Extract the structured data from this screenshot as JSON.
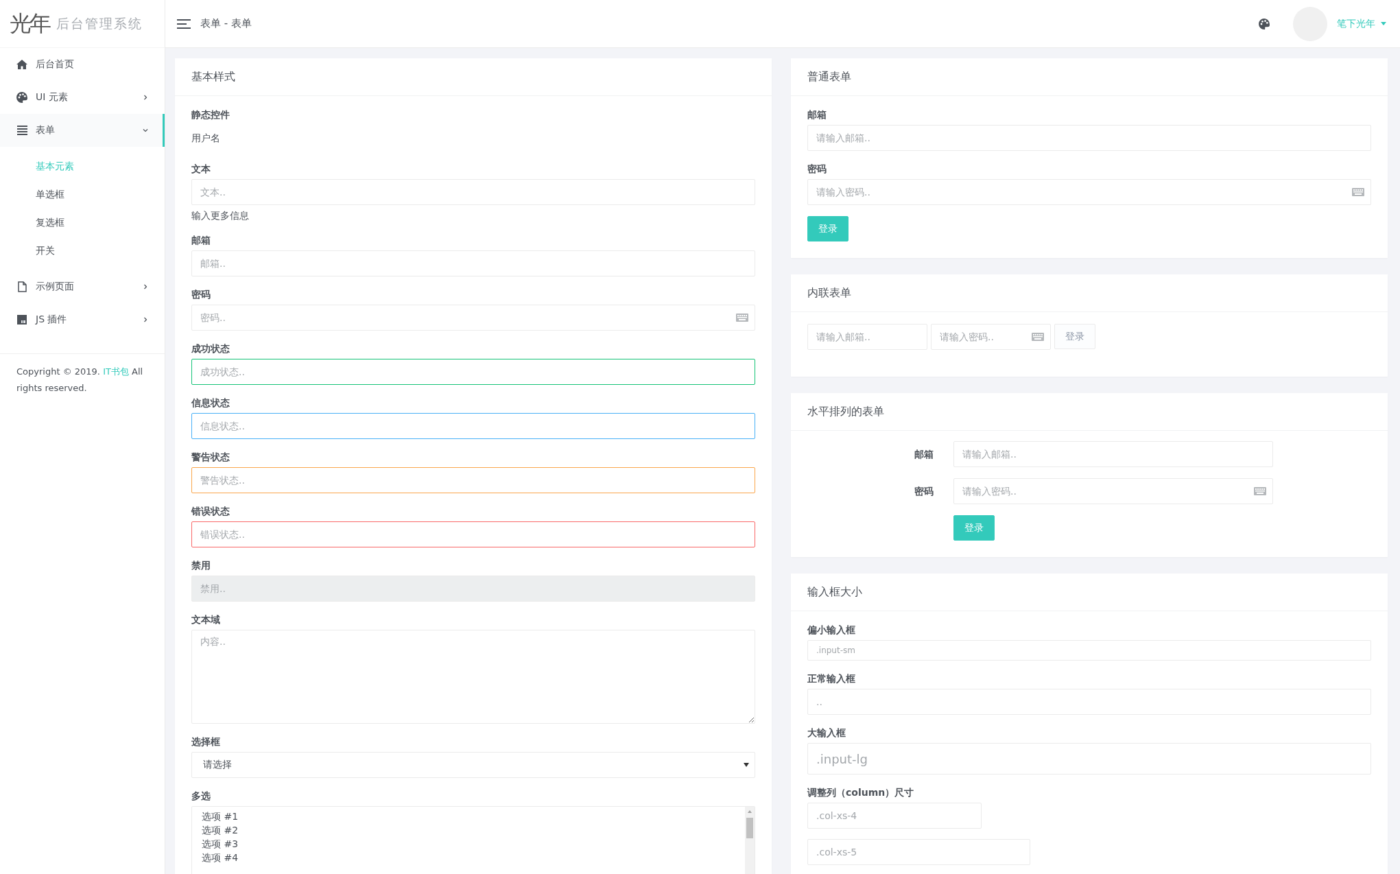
{
  "sidebar": {
    "logo": {
      "mark": "光年",
      "title": "后台管理系统"
    },
    "items": [
      {
        "kind": "link",
        "label": "后台首页",
        "selected": false
      },
      {
        "kind": "group",
        "label": "UI 元素",
        "selected": false,
        "expanded": false
      },
      {
        "kind": "group",
        "label": "表单",
        "selected": true,
        "expanded": true,
        "children": [
          {
            "label": "基本元素",
            "selected": true
          },
          {
            "label": "单选框",
            "selected": false
          },
          {
            "label": "复选框",
            "selected": false
          },
          {
            "label": "开关",
            "selected": false
          }
        ]
      },
      {
        "kind": "group",
        "label": "示例页面",
        "selected": false,
        "expanded": false
      },
      {
        "kind": "group",
        "label": "JS 插件",
        "selected": false,
        "expanded": false
      }
    ],
    "copyright": {
      "before": "Copyright © 2019.",
      "link": "IT书包",
      "after": "All rights reserved."
    }
  },
  "header": {
    "breadcrumb": "表单 - 表单",
    "user": "笔下光年"
  },
  "basic_styles": {
    "title": "基本样式",
    "fields": [
      {
        "kind": "static",
        "label": "静态控件",
        "value": "用户名"
      },
      {
        "kind": "input",
        "label": "文本",
        "placeholder": "文本..",
        "help": "输入更多信息"
      },
      {
        "kind": "input",
        "label": "邮箱",
        "placeholder": "邮箱.."
      },
      {
        "kind": "password",
        "label": "密码",
        "placeholder": "密码.."
      },
      {
        "kind": "input",
        "label": "成功状态",
        "placeholder": "成功状态..",
        "color": "#15c377"
      },
      {
        "kind": "input",
        "label": "信息状态",
        "placeholder": "信息状态..",
        "color": "#48b0f7"
      },
      {
        "kind": "input",
        "label": "警告状态",
        "placeholder": "警告状态..",
        "color": "#faa64b"
      },
      {
        "kind": "input",
        "label": "错误状态",
        "placeholder": "错误状态..",
        "color": "#f96868"
      },
      {
        "kind": "input",
        "label": "禁用",
        "placeholder": "禁用..",
        "disabled": true
      },
      {
        "kind": "textarea",
        "label": "文本域",
        "placeholder": "内容.."
      },
      {
        "kind": "select",
        "label": "选择框",
        "value": "请选择"
      },
      {
        "kind": "multiselect",
        "label": "多选",
        "options": [
          "选项 #1",
          "选项 #2",
          "选项 #3",
          "选项 #4"
        ]
      }
    ]
  },
  "normal_form": {
    "title": "普通表单",
    "fields": [
      {
        "kind": "input",
        "label": "邮箱",
        "placeholder": "请输入邮箱.."
      },
      {
        "kind": "password",
        "label": "密码",
        "placeholder": "请输入密码.."
      }
    ],
    "button": {
      "label": "登录",
      "kind": "primary"
    }
  },
  "inline_form": {
    "title": "内联表单",
    "fields": [
      {
        "kind": "input",
        "placeholder": "请输入邮箱.."
      },
      {
        "kind": "password",
        "placeholder": "请输入密码.."
      }
    ],
    "button": {
      "label": "登录",
      "kind": "default"
    }
  },
  "horizontal_form": {
    "title": "水平排列的表单",
    "fields": [
      {
        "kind": "input",
        "label": "邮箱",
        "placeholder": "请输入邮箱.."
      },
      {
        "kind": "password",
        "label": "密码",
        "placeholder": "请输入密码.."
      }
    ],
    "button": {
      "label": "登录",
      "kind": "primary"
    }
  },
  "input_sizes": {
    "title": "输入框大小",
    "fields": [
      {
        "kind": "small",
        "label": "偏小输入框",
        "placeholder": ".input-sm"
      },
      {
        "kind": "input",
        "label": "正常输入框",
        "placeholder": ".."
      },
      {
        "kind": "large",
        "label": "大输入框",
        "placeholder": ".input-lg"
      },
      {
        "kind": "columns",
        "label": "调整列（column）尺寸",
        "inputs": [
          {
            "placeholder": ".col-xs-4"
          },
          {
            "placeholder": ".col-xs-5"
          }
        ]
      }
    ]
  }
}
